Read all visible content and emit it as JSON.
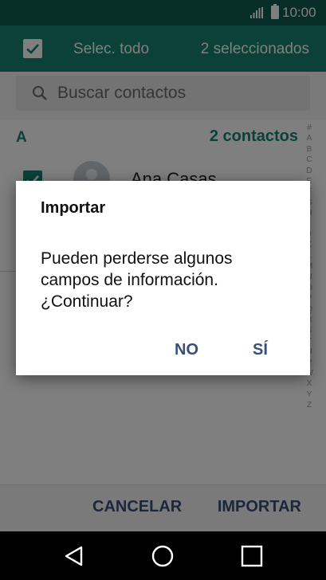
{
  "status_bar": {
    "time": "10:00"
  },
  "header": {
    "select_all_label": "Selec. todo",
    "selected_count": "2 seleccionados"
  },
  "search": {
    "placeholder": "Buscar contactos"
  },
  "list": {
    "section_letter": "A",
    "section_count": "2 contactos",
    "contacts": [
      {
        "name": "Ana Casas"
      }
    ]
  },
  "index_letters": [
    "#",
    "A",
    "B",
    "C",
    "D",
    "E",
    "F",
    "G",
    "H",
    "I",
    "J",
    "K",
    "L",
    "M",
    "N",
    "O",
    "P",
    "Q",
    "R",
    "S",
    "T",
    "U",
    "V",
    "W",
    "X",
    "Y",
    "Z"
  ],
  "footer": {
    "cancel_label": "CANCELAR",
    "import_label": "IMPORTAR"
  },
  "dialog": {
    "title": "Importar",
    "message": "Pueden perderse algunos campos de información. ¿Continuar?",
    "no_label": "NO",
    "yes_label": "SÍ"
  },
  "colors": {
    "accent": "#178272",
    "status_bar": "#0e5a50",
    "button_text": "#3a4f78"
  }
}
